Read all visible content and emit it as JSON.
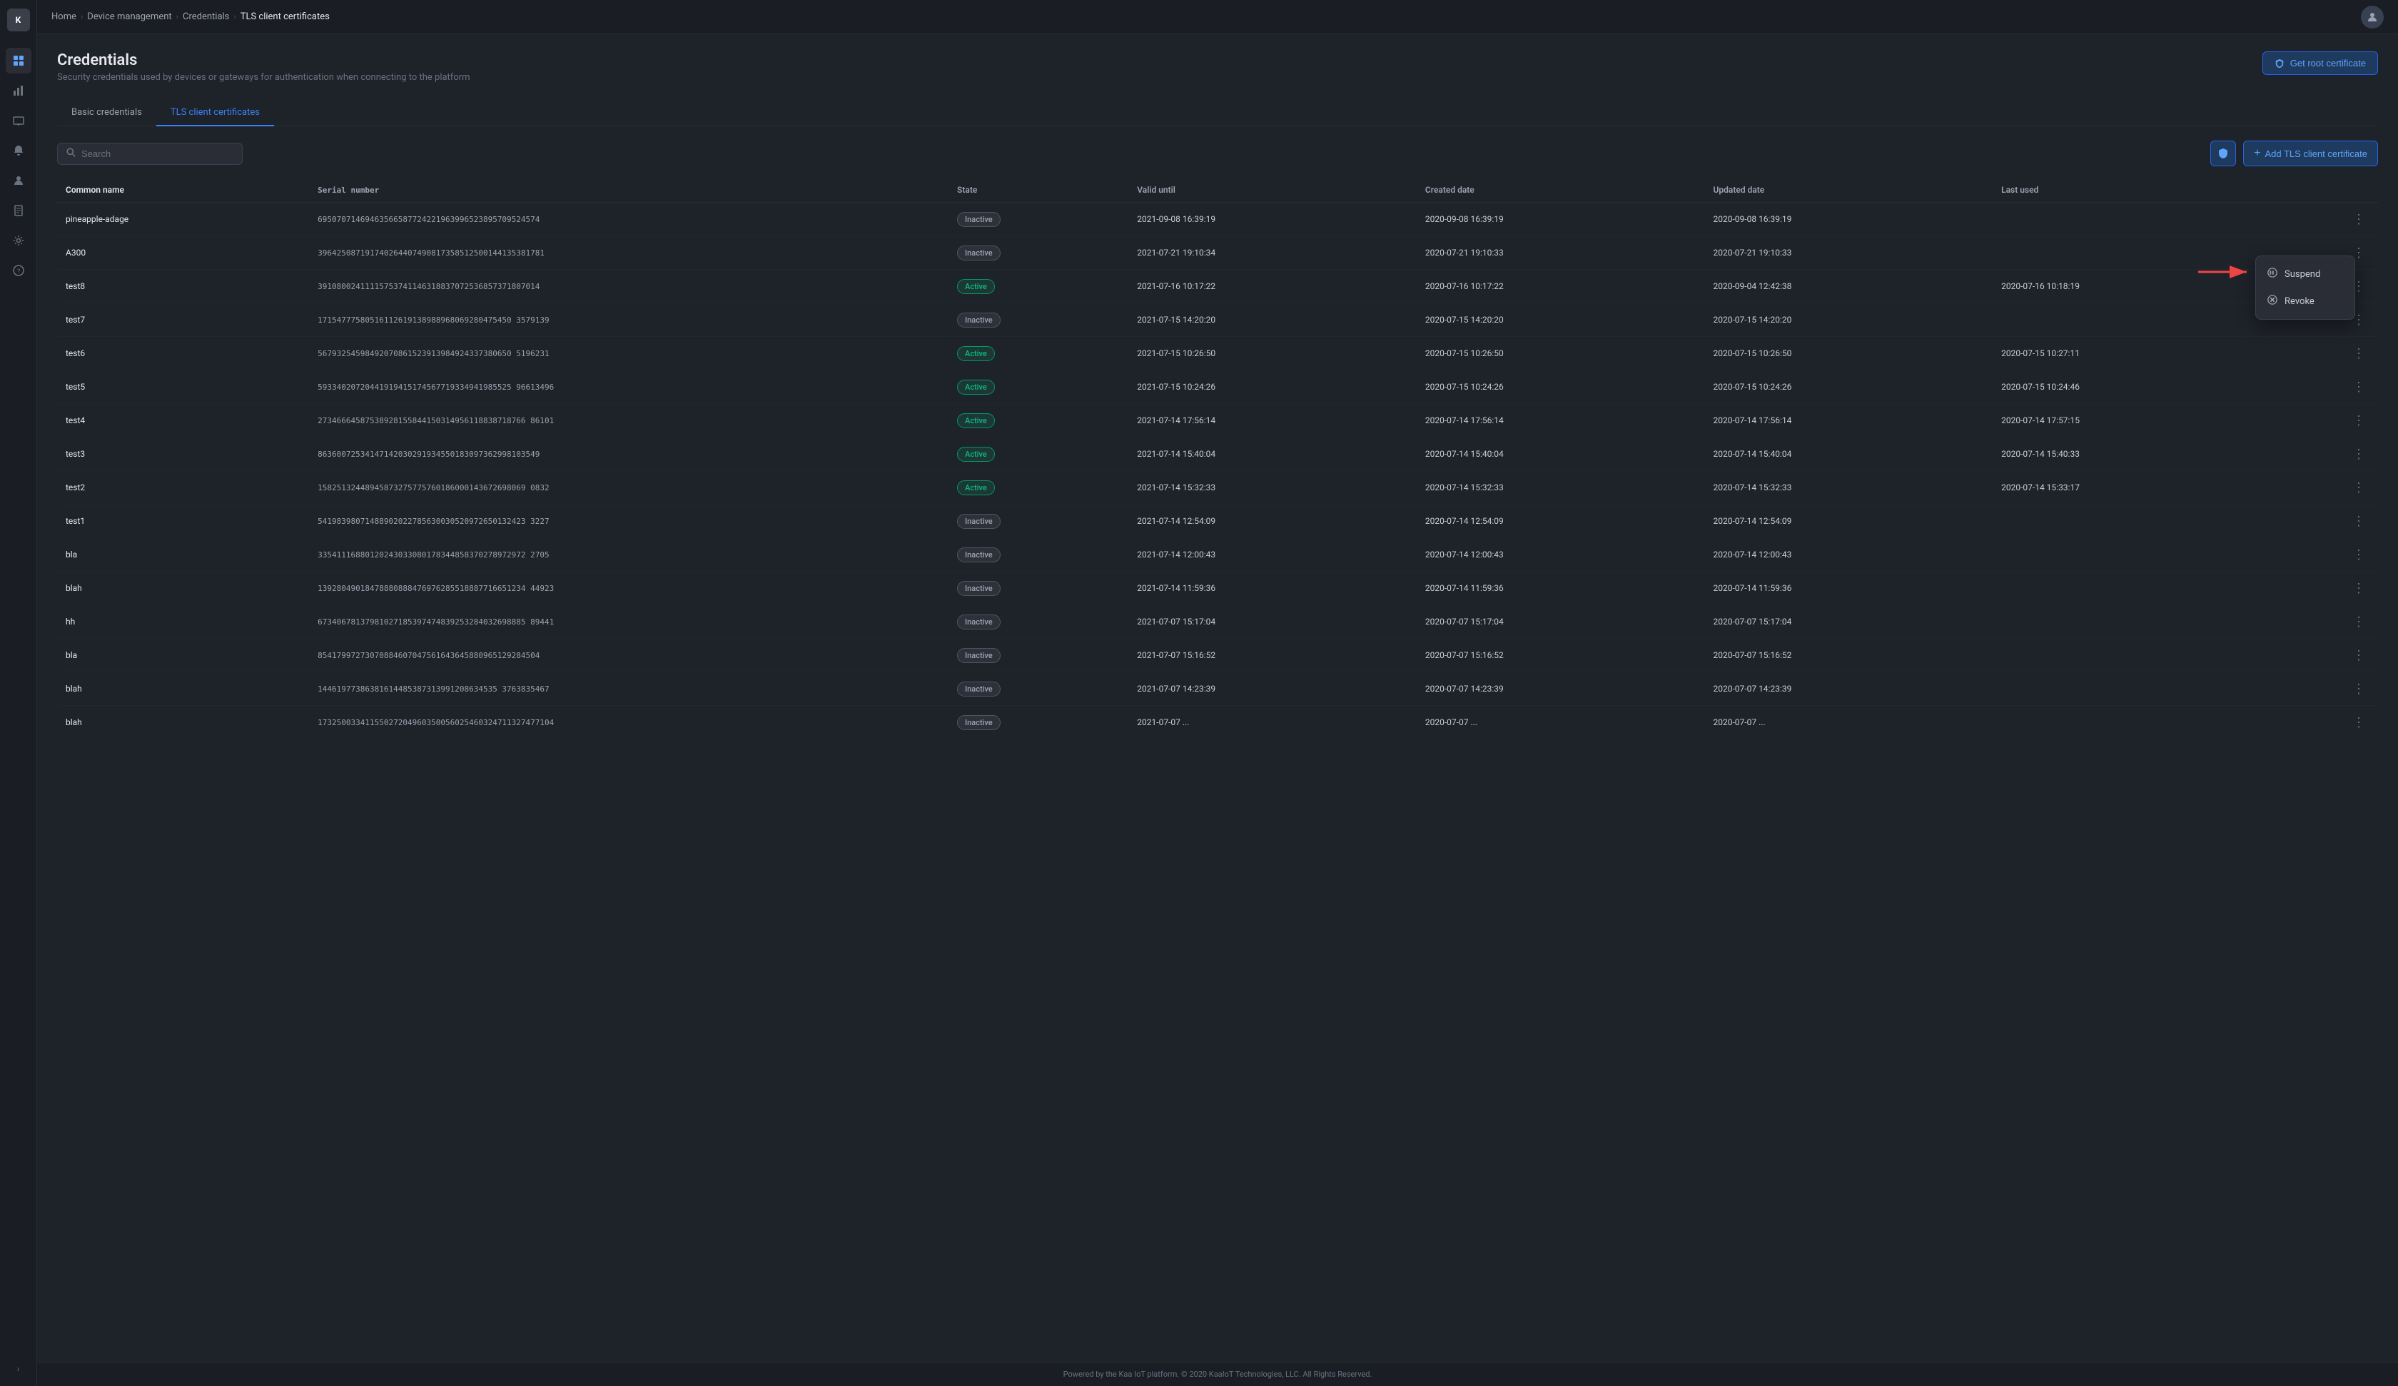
{
  "app": {
    "logo": "K"
  },
  "breadcrumb": {
    "home": "Home",
    "device_management": "Device management",
    "credentials": "Credentials",
    "current": "TLS client certificates"
  },
  "page": {
    "title": "Credentials",
    "subtitle": "Security credentials used by devices or gateways for authentication when connecting to the platform",
    "get_root_label": "Get root certificate"
  },
  "tabs": [
    {
      "id": "basic",
      "label": "Basic credentials"
    },
    {
      "id": "tls",
      "label": "TLS client certificates"
    }
  ],
  "search": {
    "placeholder": "Search"
  },
  "toolbar": {
    "add_label": "Add TLS client certificate"
  },
  "table": {
    "columns": [
      "Common name",
      "Serial number",
      "State",
      "Valid until",
      "Created date",
      "Updated date",
      "Last used"
    ],
    "rows": [
      {
        "name": "pineapple-adage",
        "serial": "69507071469463566587724221963996523895709524574",
        "state": "Inactive",
        "valid_until": "2021-09-08 16:39:19",
        "created": "2020-09-08 16:39:19",
        "updated": "2020-09-08 16:39:19",
        "last_used": ""
      },
      {
        "name": "A300",
        "serial": "396425087191740264407490817358512500144135381781",
        "state": "Inactive",
        "valid_until": "2021-07-21 19:10:34",
        "created": "2020-07-21 19:10:33",
        "updated": "2020-07-21 19:10:33",
        "last_used": ""
      },
      {
        "name": "test8",
        "serial": "39108002411115753741146318837072536857371807014",
        "state": "Active",
        "valid_until": "2021-07-16 10:17:22",
        "created": "2020-07-16 10:17:22",
        "updated": "2020-09-04 12:42:38",
        "last_used": "2020-07-16 10:18:19"
      },
      {
        "name": "test7",
        "serial": "17154777580516112619138988968069280475450 3579139",
        "state": "Inactive",
        "valid_until": "2021-07-15 14:20:20",
        "created": "2020-07-15 14:20:20",
        "updated": "2020-07-15 14:20:20",
        "last_used": ""
      },
      {
        "name": "test6",
        "serial": "56793254598492070861523913984924337380650 5196231",
        "state": "Active",
        "valid_until": "2021-07-15 10:26:50",
        "created": "2020-07-15 10:26:50",
        "updated": "2020-07-15 10:26:50",
        "last_used": "2020-07-15 10:27:11"
      },
      {
        "name": "test5",
        "serial": "59334020720441919415174567719334941985525 96613496",
        "state": "Active",
        "valid_until": "2021-07-15 10:24:26",
        "created": "2020-07-15 10:24:26",
        "updated": "2020-07-15 10:24:26",
        "last_used": "2020-07-15 10:24:46"
      },
      {
        "name": "test4",
        "serial": "27346664587538928155844150314956118838718766 86101",
        "state": "Active",
        "valid_until": "2021-07-14 17:56:14",
        "created": "2020-07-14 17:56:14",
        "updated": "2020-07-14 17:56:14",
        "last_used": "2020-07-14 17:57:15"
      },
      {
        "name": "test3",
        "serial": "86360072534147142030291934550183097362998103549",
        "state": "Active",
        "valid_until": "2021-07-14 15:40:04",
        "created": "2020-07-14 15:40:04",
        "updated": "2020-07-14 15:40:04",
        "last_used": "2020-07-14 15:40:33"
      },
      {
        "name": "test2",
        "serial": "15825132448945873275775760186000143672698069 0832",
        "state": "Active",
        "valid_until": "2021-07-14 15:32:33",
        "created": "2020-07-14 15:32:33",
        "updated": "2020-07-14 15:32:33",
        "last_used": "2020-07-14 15:33:17"
      },
      {
        "name": "test1",
        "serial": "54198398071488902022785630030520972650132423 3227",
        "state": "Inactive",
        "valid_until": "2021-07-14 12:54:09",
        "created": "2020-07-14 12:54:09",
        "updated": "2020-07-14 12:54:09",
        "last_used": ""
      },
      {
        "name": "bla",
        "serial": "33541116880120243033080178344858370278972972 2705",
        "state": "Inactive",
        "valid_until": "2021-07-14 12:00:43",
        "created": "2020-07-14 12:00:43",
        "updated": "2020-07-14 12:00:43",
        "last_used": ""
      },
      {
        "name": "blah",
        "serial": "13928049018478880888476976285518887716651234 44923",
        "state": "Inactive",
        "valid_until": "2021-07-14 11:59:36",
        "created": "2020-07-14 11:59:36",
        "updated": "2020-07-14 11:59:36",
        "last_used": ""
      },
      {
        "name": "hh",
        "serial": "67340678137981027185397474839253284032698885 89441",
        "state": "Inactive",
        "valid_until": "2021-07-07 15:17:04",
        "created": "2020-07-07 15:17:04",
        "updated": "2020-07-07 15:17:04",
        "last_used": ""
      },
      {
        "name": "bla",
        "serial": "85417997273070884607047561643645880965129284504",
        "state": "Inactive",
        "valid_until": "2021-07-07 15:16:52",
        "created": "2020-07-07 15:16:52",
        "updated": "2020-07-07 15:16:52",
        "last_used": ""
      },
      {
        "name": "blah",
        "serial": "14461977386381614485387313991208634535 3763835467",
        "state": "Inactive",
        "valid_until": "2021-07-07 14:23:39",
        "created": "2020-07-07 14:23:39",
        "updated": "2020-07-07 14:23:39",
        "last_used": ""
      },
      {
        "name": "blah",
        "serial": "17325003341155027204960350056025460324711327477104",
        "state": "Inactive",
        "valid_until": "2021-07-07 ...",
        "created": "2020-07-07 ...",
        "updated": "2020-07-07 ...",
        "last_used": ""
      }
    ]
  },
  "context_menu": {
    "suspend_label": "Suspend",
    "revoke_label": "Revoke"
  },
  "footer": {
    "text": "Powered by the Kaa IoT platform. © 2020 KaaIoT Technologies, LLC. All Rights Reserved."
  },
  "sidebar": {
    "icons": [
      {
        "name": "grid-icon",
        "symbol": "⊞",
        "active": true
      },
      {
        "name": "chart-icon",
        "symbol": "📊"
      },
      {
        "name": "devices-icon",
        "symbol": "💻"
      },
      {
        "name": "user-icon",
        "symbol": "👤"
      },
      {
        "name": "document-icon",
        "symbol": "📄"
      },
      {
        "name": "bell-icon",
        "symbol": "🔔"
      },
      {
        "name": "person-icon",
        "symbol": "🧑"
      },
      {
        "name": "settings-icon",
        "symbol": "⚙"
      },
      {
        "name": "help-icon",
        "symbol": "?"
      }
    ],
    "expand_label": "›"
  }
}
